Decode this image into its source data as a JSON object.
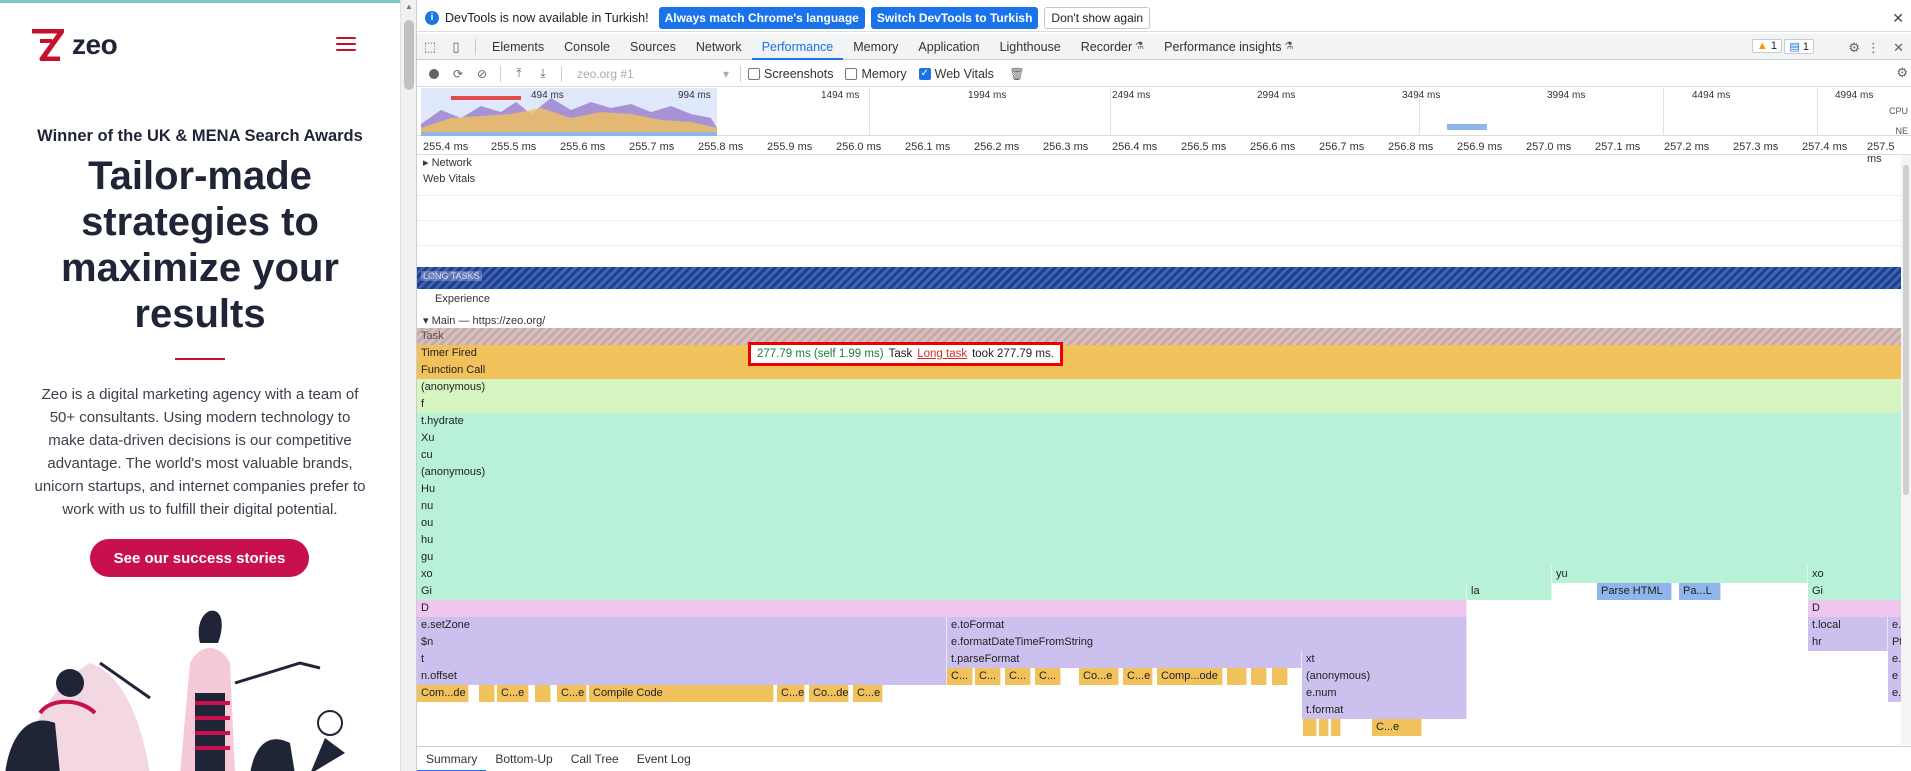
{
  "site": {
    "logo_text": "zeo",
    "award": "Winner of the UK & MENA Search Awards",
    "headline_lines": [
      "Tailor-made",
      "strategies to",
      "maximize your",
      "results"
    ],
    "description": "Zeo is a digital marketing agency with a team of 50+ consultants. Using modern technology to make data-driven decisions is our competitive advantage. The world's most valuable brands, unicorn startups, and internet companies prefer to work with us to fulfill their digital potential.",
    "cta_label": "See our success stories",
    "brand_color": "#c8104f"
  },
  "infobar": {
    "message": "DevTools is now available in Turkish!",
    "btn_match": "Always match Chrome's language",
    "btn_switch": "Switch DevTools to Turkish",
    "btn_dismiss": "Don't show again",
    "close": "✕"
  },
  "tabs": [
    "Elements",
    "Console",
    "Sources",
    "Network",
    "Performance",
    "Memory",
    "Application",
    "Lighthouse",
    "Recorder",
    "Performance insights"
  ],
  "active_tab": "Performance",
  "badges": {
    "warnings": "1",
    "messages": "1"
  },
  "perf_toolbar": {
    "profile": "zeo.org #1",
    "screenshots_label": "Screenshots",
    "memory_label": "Memory",
    "webvitals_label": "Web Vitals",
    "webvitals_checked": true
  },
  "overview": {
    "labels": [
      "494 ms",
      "994 ms",
      "1494 ms",
      "1994 ms",
      "2494 ms",
      "2994 ms",
      "3494 ms",
      "3994 ms",
      "4494 ms",
      "4994 ms"
    ],
    "side_labels": [
      "CPU",
      "NE"
    ]
  },
  "ruler": [
    "255.4 ms",
    "255.5 ms",
    "255.6 ms",
    "255.7 ms",
    "255.8 ms",
    "255.9 ms",
    "256.0 ms",
    "256.1 ms",
    "256.2 ms",
    "256.3 ms",
    "256.4 ms",
    "256.5 ms",
    "256.6 ms",
    "256.7 ms",
    "256.8 ms",
    "256.9 ms",
    "257.0 ms",
    "257.1 ms",
    "257.2 ms",
    "257.3 ms",
    "257.4 ms",
    "257.5 ms"
  ],
  "tracks": {
    "network": "Network",
    "webvitals": "Web Vitals",
    "long_tasks": "LONG TASKS",
    "experience": "Experience",
    "main": "Main — https://zeo.org/"
  },
  "flame_rows": [
    "Task",
    "Timer Fired",
    "Function Call",
    "(anonymous)",
    "f",
    "t.hydrate",
    "Xu",
    "cu",
    "(anonymous)",
    "Hu",
    "nu",
    "ou",
    "hu",
    "gu",
    "xo",
    "Gi",
    "D",
    "e.setZone",
    "$n",
    "t",
    "n.offset"
  ],
  "flame_extra": {
    "yu": "yu",
    "la": "la",
    "parse_html": "Parse HTML",
    "pa_l": "Pa...L",
    "xo_r": "xo",
    "gi_r": "Gi",
    "d_r": "D",
    "to_format": "e.toFormat",
    "format_dt": "e.formatDateTimeFromString",
    "parse_format": "t.parseFormat",
    "xt": "xt",
    "anon2": "(anonymous)",
    "enum": "e.num",
    "tformat": "t.format",
    "tlocal": "t.local",
    "hr": "hr",
    "pt": "Pt",
    "e1": "e...",
    "e2": "e...",
    "e3": "e",
    "e4": "e...",
    "compile_code": "Compile Code",
    "com_de": "Com...de",
    "c_e1": "C...e",
    "c_e2": "C...e",
    "c_e3": "C...e",
    "co_de": "Co...de",
    "c_e4": "C...e",
    "comp_ode": "Comp...ode",
    "co_e": "Co...e",
    "c_e5": "C...e",
    "c1": "C...",
    "c2": "C...",
    "c3": "C...",
    "c4": "C...",
    "c_e6": "C...e"
  },
  "tooltip": {
    "time": "277.79 ms (self 1.99 ms)",
    "name": "Task",
    "link": "Long task",
    "suffix": "took 277.79 ms."
  },
  "bottom_tabs": [
    "Summary",
    "Bottom-Up",
    "Call Tree",
    "Event Log"
  ]
}
